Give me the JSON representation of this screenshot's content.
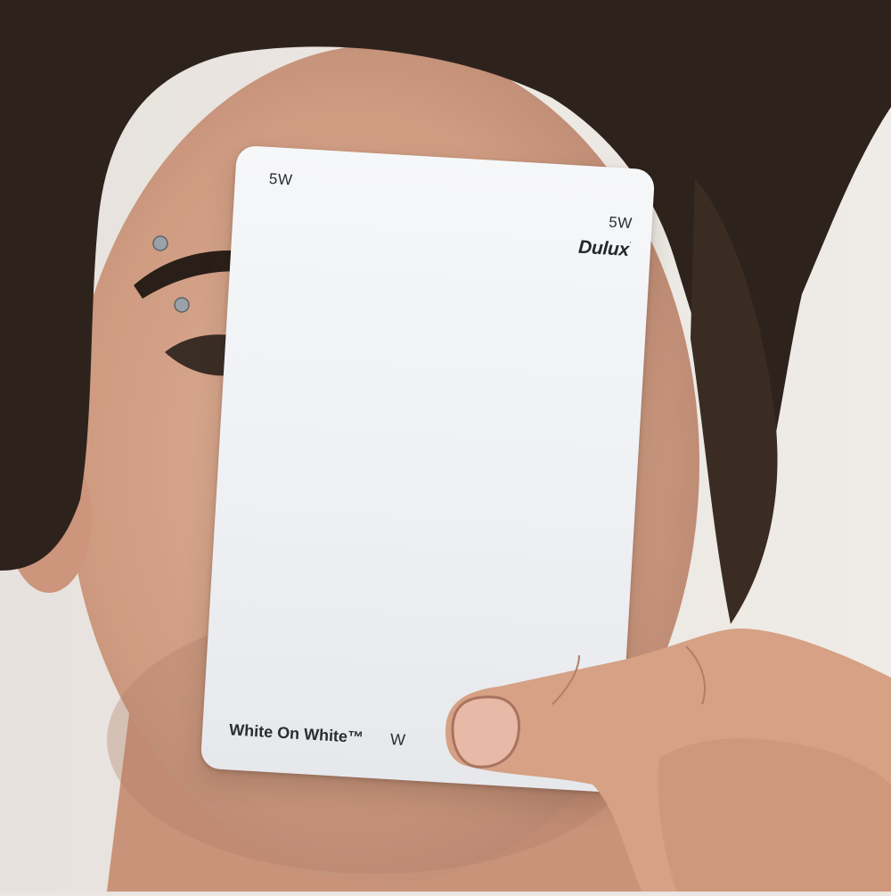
{
  "photo": {
    "subject": "person-holding-paint-swatch",
    "background_color": "#ebe6e1",
    "hair_color": "#2e231c",
    "skin_color": "#d6a88e"
  },
  "swatch": {
    "code_top": "5W",
    "code_side": "5W",
    "brand": "Dulux",
    "brand_mark": "·",
    "collection": "White On White™",
    "series": "W",
    "card_color": "#f1f2f5",
    "text_color": "#2b2d31"
  }
}
